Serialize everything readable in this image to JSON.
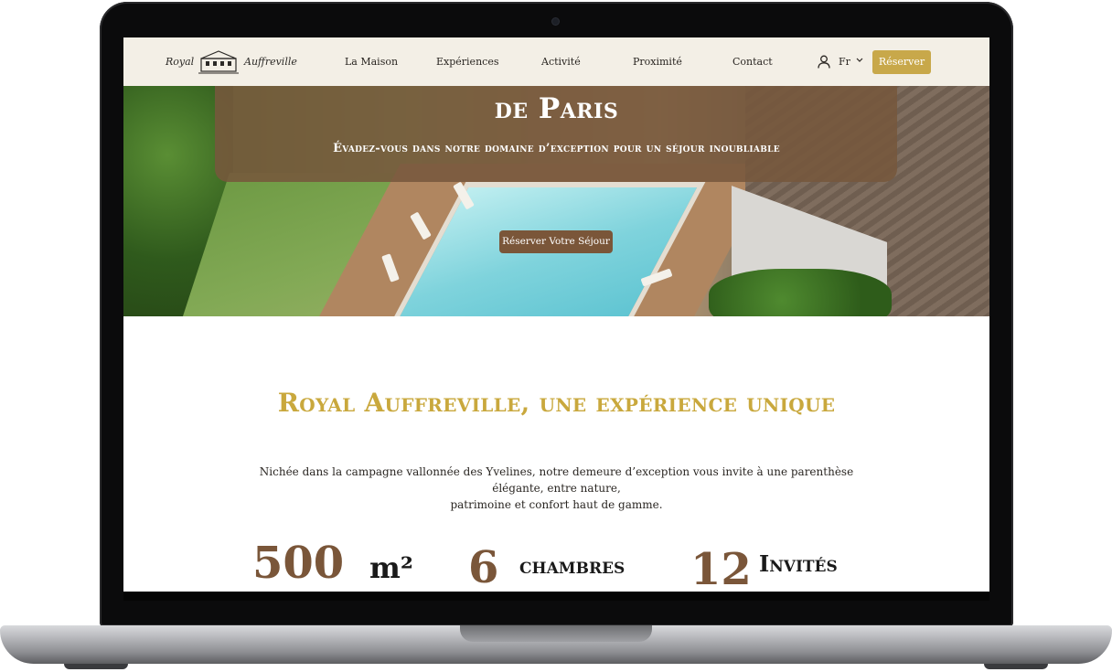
{
  "nav": {
    "logo_left": "Royal",
    "logo_right": "Auffreville",
    "items": [
      {
        "label": "La Maison"
      },
      {
        "label": "Expériences"
      },
      {
        "label": "Activité"
      },
      {
        "label": "Proximité"
      },
      {
        "label": "Contact"
      }
    ],
    "language": "Fr",
    "reserve_label": "Réserver"
  },
  "hero": {
    "title": "de Paris",
    "subtitle": "Évadez-vous dans notre domaine d’exception pour un séjour inoubliable",
    "button_label": "Réserver Votre Séjour"
  },
  "content": {
    "title": "Royal Auffreville, une expérience unique",
    "intro_line1": "Nichée dans la campagne vallonnée des Yvelines, notre demeure d’exception vous invite à une parenthèse élégante, entre nature,",
    "intro_line2": "patrimoine et confort haut de gamme."
  },
  "stats": [
    {
      "value": "500",
      "label": "m²"
    },
    {
      "value": "6",
      "label": "chambres"
    },
    {
      "value": "12",
      "label": "Invités"
    }
  ],
  "colors": {
    "accent_gold": "#c8a84a",
    "brown": "#7a5639",
    "nav_bg": "#f3efe6"
  },
  "icons": [
    "house-logo-icon",
    "user-icon",
    "chevron-down-icon",
    "webcam-icon"
  ]
}
